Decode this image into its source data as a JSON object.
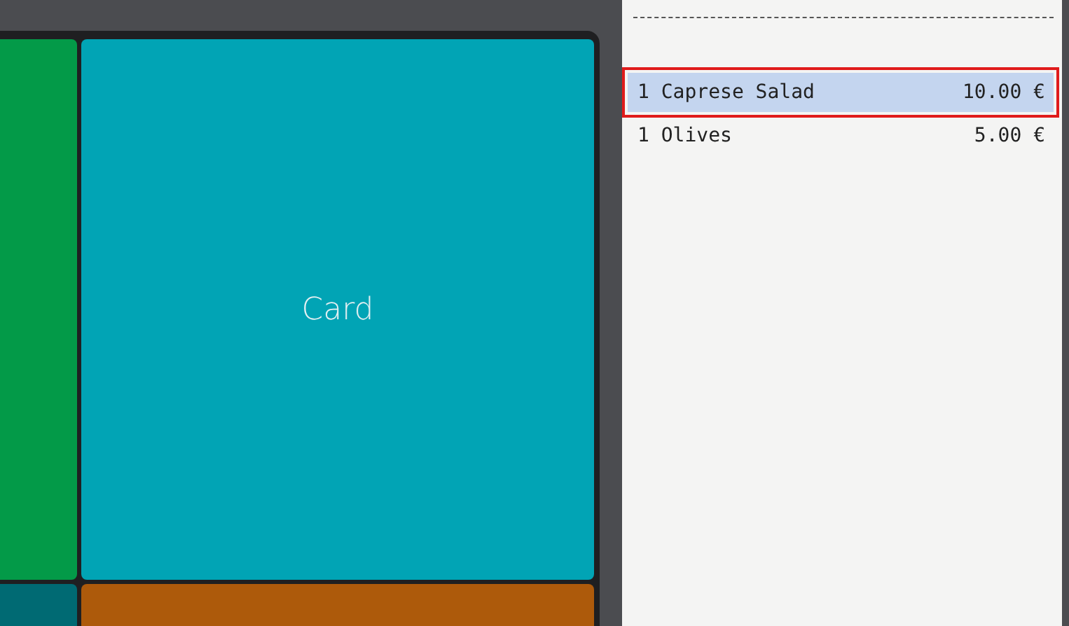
{
  "tiles": [
    {
      "color": "#039a48"
    },
    {
      "label": "Card",
      "color": "#01a4b5"
    },
    {
      "color": "#006a73"
    },
    {
      "color": "#ad5a0b"
    }
  ],
  "receipt": {
    "lines": [
      {
        "qty": "1",
        "name": "Caprese Salad",
        "price": "10.00 €",
        "selected": true
      },
      {
        "qty": "1",
        "name": "Olives",
        "price": "5.00 €",
        "selected": false
      }
    ]
  }
}
